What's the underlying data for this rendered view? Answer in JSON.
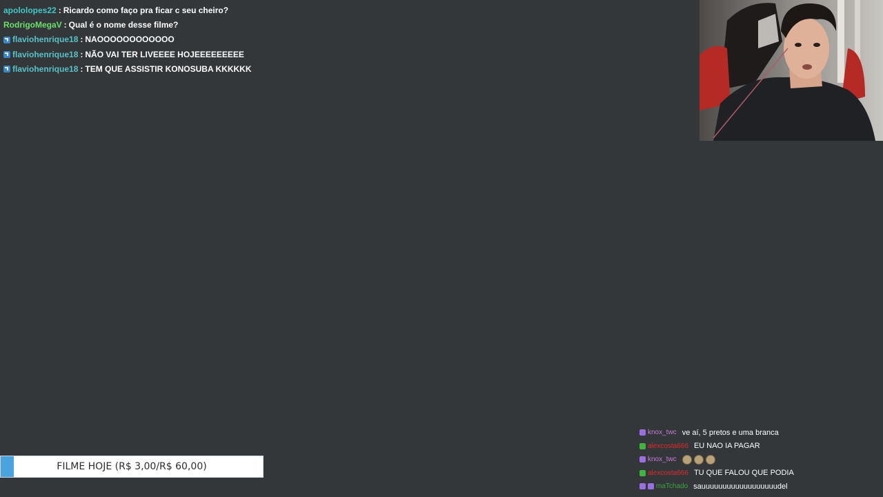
{
  "chat": {
    "messages": [
      {
        "user": "apololopes22",
        "user_color": "#42c7c7",
        "badge": "",
        "text": "Ricardo como faço pra ficar c seu cheiro?"
      },
      {
        "user": "RodrigoMegaV",
        "user_color": "#6be06b",
        "badge": "",
        "text": "Qual é o nome desse filme?"
      },
      {
        "user": "flaviohenrique18",
        "user_color": "#59c1c8",
        "badge": "blue",
        "text": "NAOOOOOOOOOOOO"
      },
      {
        "user": "flaviohenrique18",
        "user_color": "#59c1c8",
        "badge": "blue",
        "text": "NÃO VAI TER LIVEEEE HOJEEEEEEEEE"
      },
      {
        "user": "flaviohenrique18",
        "user_color": "#59c1c8",
        "badge": "blue",
        "text": "TEM QUE ASSISTIR KONOSUBA KKKKKK"
      }
    ]
  },
  "chat2": {
    "messages": [
      {
        "user": "knox_twc",
        "user_color": "#c77ad8",
        "badges": [
          "purple"
        ],
        "text": "ve aí, 5 pretos e uma branca",
        "emotes": 0
      },
      {
        "user": "alexcosta666",
        "user_color": "#e02b2b",
        "badges": [
          "green"
        ],
        "text": "EU NAO IA PAGAR",
        "emotes": 0
      },
      {
        "user": "knox_twc",
        "user_color": "#c77ad8",
        "badges": [
          "purple"
        ],
        "text": "",
        "emotes": 3
      },
      {
        "user": "alexcosta666",
        "user_color": "#e02b2b",
        "badges": [
          "green"
        ],
        "text": "TU QUE FALOU QUE PODIA",
        "emotes": 0
      },
      {
        "user": "maTchado",
        "user_color": "#3aa83a",
        "badges": [
          "purple",
          "purple"
        ],
        "text": "sauuuuuuuuuuuuuuuuuudel",
        "emotes": 0
      }
    ]
  },
  "goal": {
    "label": "FILME HOJE (R$ 3,00/R$ 60,00)",
    "current": 3.0,
    "target": 60.0,
    "fill_color": "#4aa3df"
  },
  "webcam": {
    "description_icon": "webcam-feed"
  }
}
